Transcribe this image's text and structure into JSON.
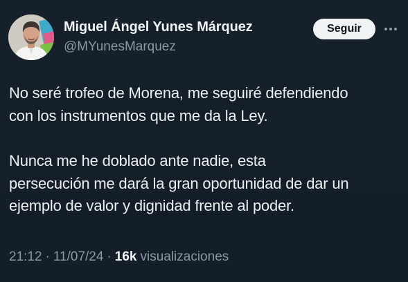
{
  "author": {
    "display_name": "Miguel Ángel Yunes Márquez",
    "handle": "@MYunesMarquez",
    "avatar_icon": "profile-photo"
  },
  "actions": {
    "follow_label": "Seguir",
    "more_icon": "more-options-icon"
  },
  "tweet": {
    "paragraphs": [
      "No seré trofeo de Morena, me seguiré defendiendo\ncon los instrumentos que me da la Ley.",
      "Nunca me he doblado ante nadie, esta\npersecución me dará la gran oportunidad de dar un\nejemplo de valor y dignidad frente al poder."
    ]
  },
  "meta": {
    "time": "21:12",
    "separator": "·",
    "date": "11/07/24",
    "views_count": "16k",
    "views_label": "visualizaciones"
  },
  "colors": {
    "background": "#15202b",
    "text_primary": "#e7e9ea",
    "text_secondary": "#8b98a5",
    "button_bg": "#eff3f4",
    "button_text": "#0f1419"
  }
}
